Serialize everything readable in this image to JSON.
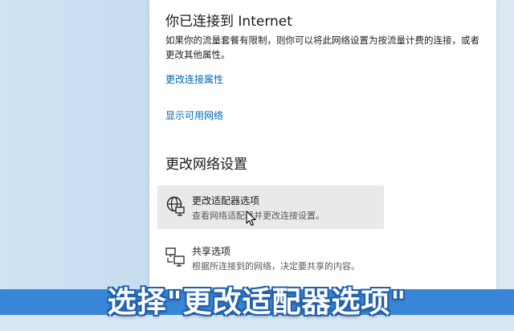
{
  "status": {
    "heading": "你已连接到 Internet",
    "description": "如果你的流量套餐有限制，则你可以将此网络设置为按流量计费的连接，或者更改其他属性。"
  },
  "links": {
    "change_connection_properties": "更改连接属性",
    "show_available_networks": "显示可用网络"
  },
  "change_settings": {
    "heading": "更改网络设置",
    "options": [
      {
        "title": "更改适配器选项",
        "description": "查看网络适配器并更改连接设置。",
        "icon": "network-adapter-icon",
        "hovered": true
      },
      {
        "title": "共享选项",
        "description": "根据所连接到的网络，决定要共享的内容。",
        "icon": "sharing-icon",
        "hovered": false
      }
    ]
  },
  "subtitle": "选择\"更改适配器选项\"",
  "colors": {
    "link": "#0067b8",
    "hover_bg": "#e9e9e9",
    "banner": "#3a86d6"
  }
}
